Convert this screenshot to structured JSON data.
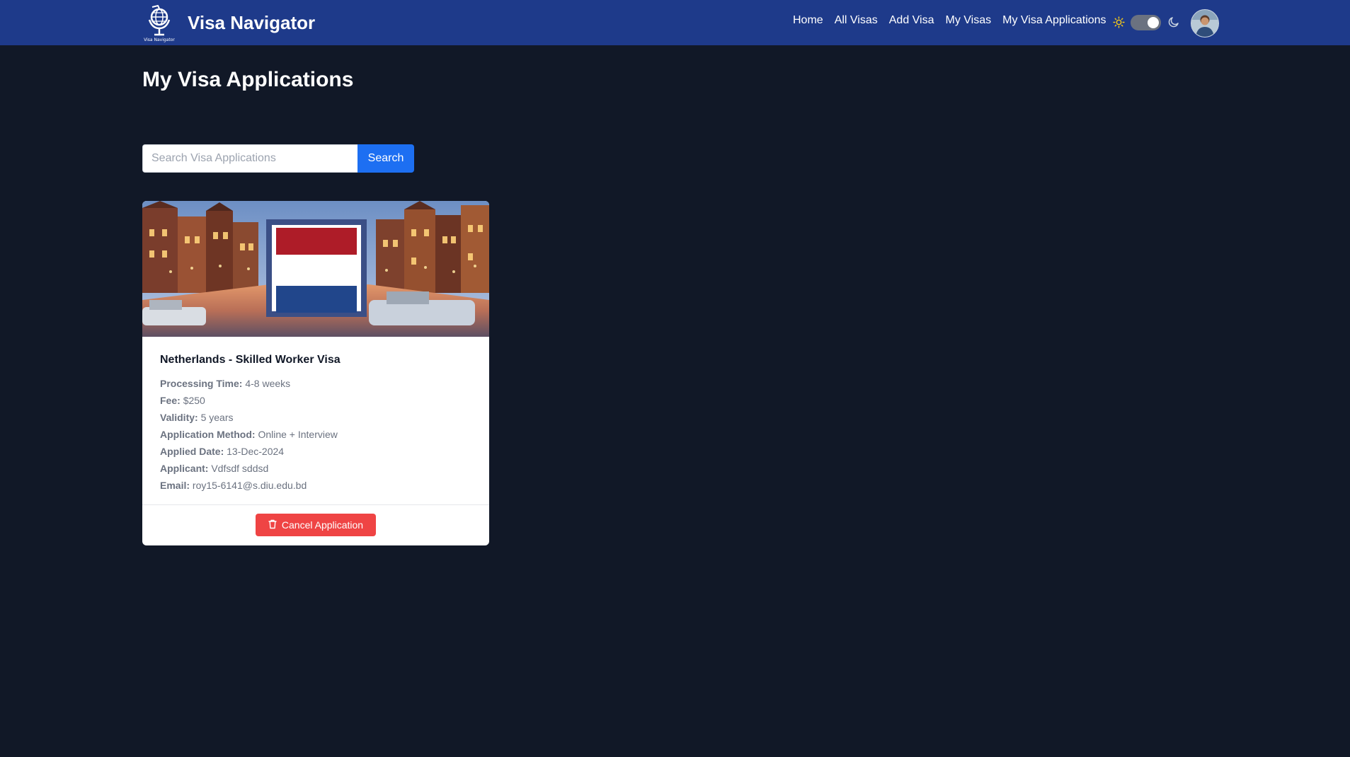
{
  "navbar": {
    "logo_icon": "globe-satellite-logo",
    "logo_caption": "Visa Navigator",
    "brand": "Visa Navigator",
    "links": [
      "Home",
      "All Visas",
      "Add Visa",
      "My Visas",
      "My Visa Applications"
    ],
    "theme_toggle": {
      "light_icon": "sun-icon",
      "dark_icon": "moon-icon",
      "state": "dark"
    },
    "bg_color": "#1e3a8a"
  },
  "main": {
    "title": "My Visa Applications",
    "search": {
      "placeholder": "Search Visa Applications",
      "value": "",
      "button_label": "Search"
    }
  },
  "applications": [
    {
      "image": "netherlands-canal-flag-image",
      "title": "Netherlands - Skilled Worker Visa",
      "details": [
        {
          "label": "Processing Time:",
          "value": "4-8 weeks"
        },
        {
          "label": "Fee:",
          "value": "$250"
        },
        {
          "label": "Validity:",
          "value": "5 years"
        },
        {
          "label": "Application Method:",
          "value": "Online + Interview"
        },
        {
          "label": "Applied Date:",
          "value": "13-Dec-2024"
        },
        {
          "label": "Applicant:",
          "value": "Vdfsdf sddsd"
        },
        {
          "label": "Email:",
          "value": "roy15-6141@s.diu.edu.bd"
        }
      ],
      "cancel_label": "Cancel Application",
      "cancel_icon": "trash-icon"
    }
  ],
  "colors": {
    "page_bg": "#111827",
    "primary": "#1d6ff2",
    "danger": "#ef4444"
  }
}
